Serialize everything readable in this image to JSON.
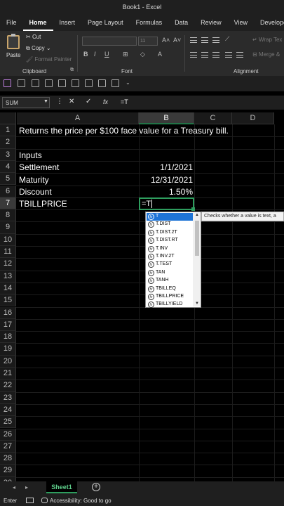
{
  "window": {
    "title": "Book1  -  Excel"
  },
  "ribbon_tabs": [
    {
      "label": "File"
    },
    {
      "label": "Home",
      "active": true
    },
    {
      "label": "Insert"
    },
    {
      "label": "Page Layout"
    },
    {
      "label": "Formulas"
    },
    {
      "label": "Data"
    },
    {
      "label": "Review"
    },
    {
      "label": "View"
    },
    {
      "label": "Develope"
    }
  ],
  "ribbon": {
    "paste_label": "Paste",
    "cut_label": "Cut",
    "copy_label": "Copy",
    "format_painter_label": "Format Painter",
    "clipboard_group": "Clipboard",
    "font_group": "Font",
    "font_size": "11",
    "alignment_group": "Alignment",
    "wrap_text_label": "Wrap Tex",
    "merge_label": "Merge &"
  },
  "formula_bar": {
    "name_box": "SUM",
    "formula": "=T"
  },
  "columns": [
    "A",
    "B",
    "C",
    "D"
  ],
  "rows": [
    "1",
    "2",
    "3",
    "4",
    "5",
    "6",
    "7",
    "8",
    "9",
    "10",
    "11",
    "12",
    "13",
    "14",
    "15",
    "16",
    "17",
    "18",
    "19",
    "20",
    "21",
    "22",
    "23",
    "24",
    "25",
    "26",
    "27",
    "28",
    "29",
    "30"
  ],
  "cells": {
    "a1": "Returns the price per $100 face value for a Treasury bill.",
    "a3": "Inputs",
    "a4": "Settlement",
    "b4": "1/1/2021",
    "a5": "Maturity",
    "b5": "12/31/2021",
    "a6": "Discount",
    "b6": "1.50%",
    "a7": "TBILLPRICE",
    "b7": "=T"
  },
  "autocomplete": {
    "items": [
      "T",
      "T.DIST",
      "T.DIST.2T",
      "T.DIST.RT",
      "T.INV",
      "T.INV.2T",
      "T.TEST",
      "TAN",
      "TANH",
      "TBILLEQ",
      "TBILLPRICE",
      "TBILLYIELD"
    ],
    "selected_index": 0,
    "tooltip": "Checks whether a value is text, a"
  },
  "sheets": [
    {
      "label": "Sheet1",
      "active": true
    }
  ],
  "status": {
    "mode": "Enter",
    "accessibility": "Accessibility: Good to go"
  },
  "colors": {
    "accent_green": "#2e9e5e",
    "selection_blue": "#1e74d6",
    "background": "#000000"
  }
}
